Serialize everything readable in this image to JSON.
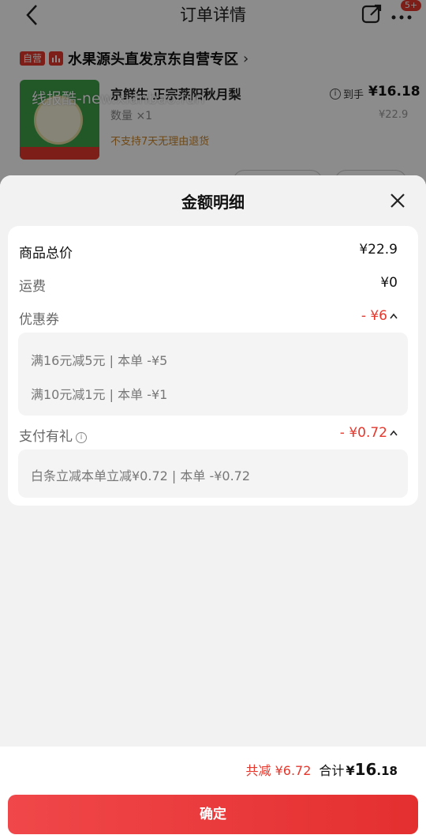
{
  "nav": {
    "title": "订单详情",
    "badge": "5+"
  },
  "shop": {
    "tag": "自营",
    "name": "水果源头直发京东自营专区",
    "chevron": "›"
  },
  "product": {
    "title": "京鲜生 正宗莱阳秋月梨",
    "quantity": "数量 ×1",
    "no_return": "不支持7天无理由退货",
    "price_label": "到手",
    "price": "¥16.18",
    "orig_price": "¥22.9"
  },
  "watermark": "线报酷-new.xianbao.fun",
  "sheet": {
    "title": "金额明细",
    "rows": {
      "total_label": "商品总价",
      "total_value": "¥22.9",
      "ship_label": "运费",
      "ship_value": "¥0",
      "coupon_label": "优惠券",
      "coupon_value": "- ¥6",
      "gift_label": "支付有礼",
      "gift_value": "- ¥0.72"
    },
    "coupons": [
      "满16元减5元 | 本单 -¥5",
      "满10元减1元 | 本单 -¥1"
    ],
    "gifts": [
      "白条立减本单立减¥0.72 | 本单 -¥0.72"
    ]
  },
  "footer": {
    "discount": "共减 ¥6.72",
    "total_label": "合计",
    "total_currency": "¥",
    "total_int": "16",
    "total_dec": ".18",
    "confirm": "确定"
  },
  "colors": {
    "accent": "#e5372c",
    "button_start": "#f0474a",
    "button_end": "#e42f2f"
  },
  "icons": [
    "back-icon",
    "share-icon",
    "more-icon",
    "close-icon",
    "info-icon",
    "chevron-up-icon"
  ]
}
